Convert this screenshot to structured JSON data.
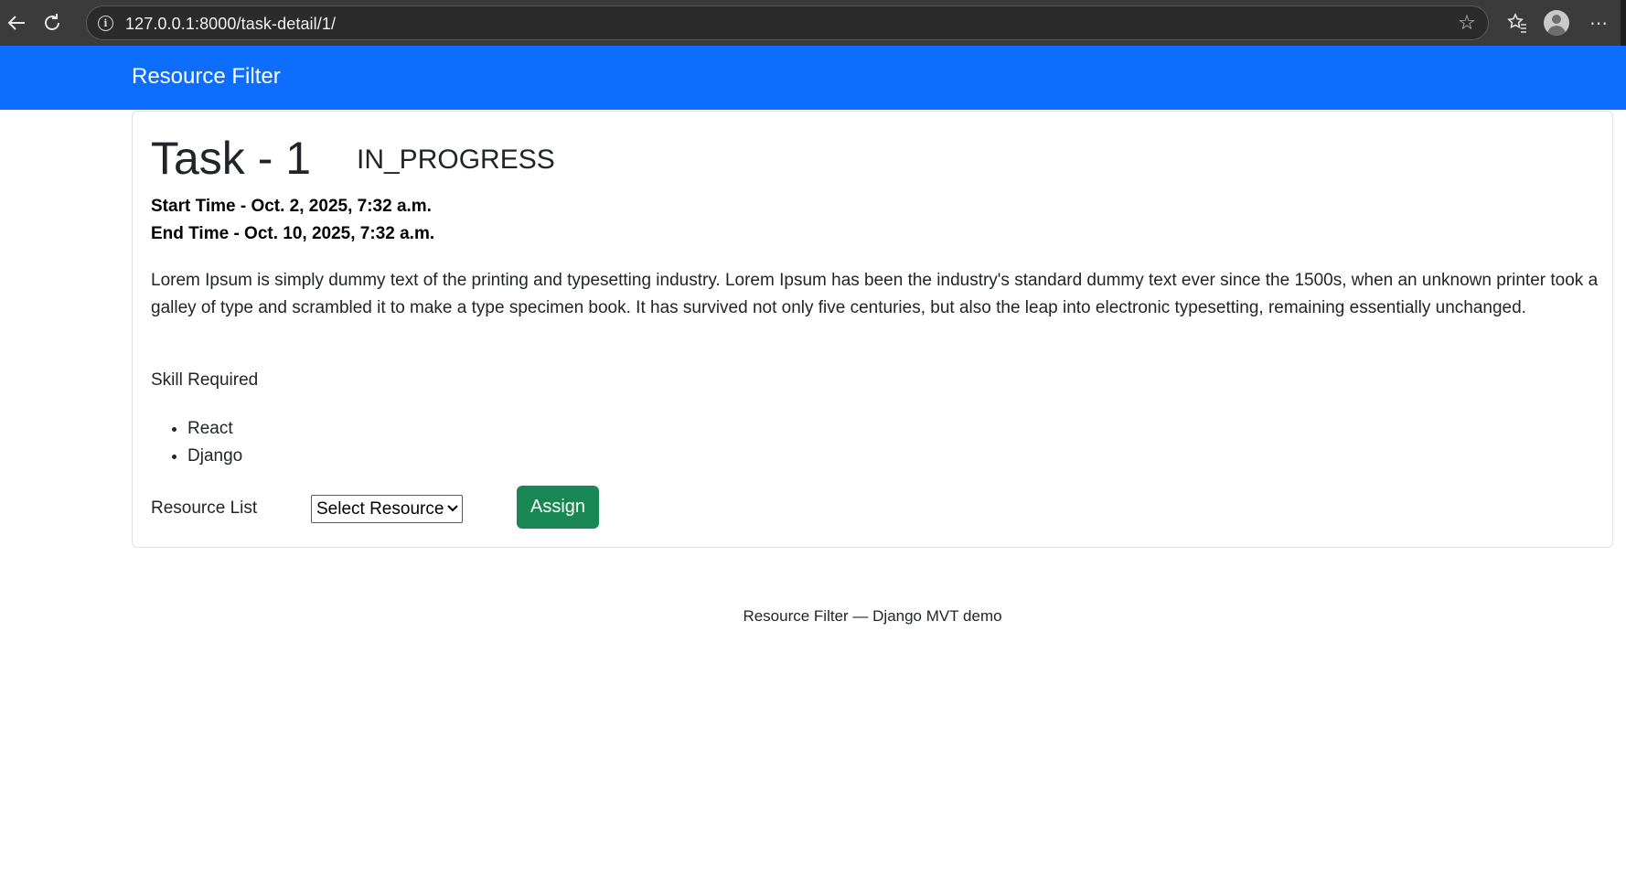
{
  "browser": {
    "url": "127.0.0.1:8000/task-detail/1/",
    "back_icon": "arrow-left-icon",
    "reload_icon": "reload-icon",
    "favorite_icon": "star-icon",
    "collections_icon": "star-list-icon",
    "profile_icon": "avatar-icon",
    "menu_icon": "more-icon"
  },
  "navbar": {
    "brand": "Resource Filter",
    "color": "#0d6efd"
  },
  "task": {
    "title": "Task - 1",
    "status": "IN_PROGRESS",
    "start_time": "Start Time - Oct. 2, 2025, 7:32 a.m.",
    "end_time": "End Time - Oct. 10, 2025, 7:32 a.m.",
    "description": "Lorem Ipsum is simply dummy text of the printing and typesetting industry. Lorem Ipsum has been the industry's standard dummy text ever since the 1500s, when an unknown printer took a galley of type and scrambled it to make a type specimen book. It has survived not only five centuries, but also the leap into electronic typesetting, remaining essentially unchanged.",
    "skill_label": "Skill Required",
    "skills": [
      "React",
      "Django"
    ]
  },
  "assignment": {
    "resource_label": "Resource List",
    "select_value": "Select Resource",
    "assign_button": "Assign",
    "button_color": "#198754"
  },
  "footer": {
    "text": "Resource Filter — Django MVT demo"
  }
}
